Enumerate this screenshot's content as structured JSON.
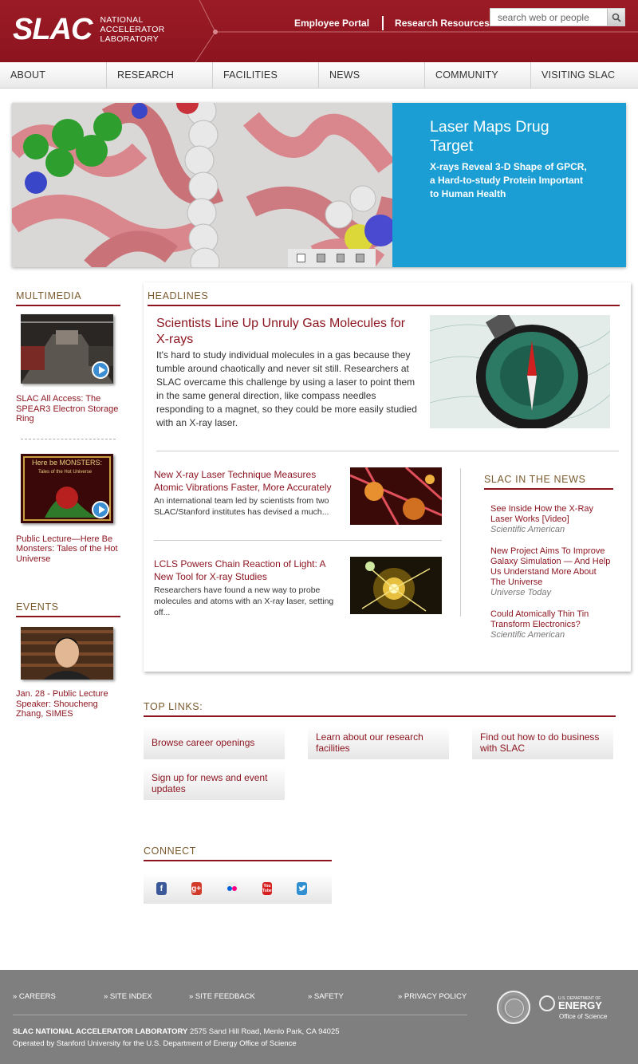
{
  "header": {
    "logo": "SLAC",
    "logo_line1": "NATIONAL",
    "logo_line2": "ACCELERATOR",
    "logo_line3": "LABORATORY",
    "links": [
      "Employee Portal",
      "Research Resources"
    ],
    "search_placeholder": "search web or people",
    "brand_color": "#8c141f"
  },
  "nav": [
    "ABOUT",
    "RESEARCH",
    "FACILITIES",
    "NEWS",
    "COMMUNITY",
    "VISITING SLAC"
  ],
  "slider": {
    "title": "Laser Maps Drug Target",
    "subtitle": "X-rays Reveal 3-D Shape of GPCR, a Hard-to-study Protein Important to Human Health",
    "panel_color": "#1b9ed3",
    "pages": 4,
    "active_page": 1
  },
  "multimedia": {
    "heading": "MULTIMEDIA",
    "items": [
      {
        "caption": "SLAC All Access: The SPEAR3 Electron Storage Ring"
      },
      {
        "caption": "Public Lecture—Here Be Monsters: Tales of the Hot Universe",
        "thumb_text1": "Here be MONSTERS:",
        "thumb_text2": "Tales of the Hot Universe"
      }
    ]
  },
  "events": {
    "heading": "EVENTS",
    "items": [
      {
        "caption": "Jan. 28 - Public Lecture Speaker: Shoucheng Zhang, SIMES"
      }
    ]
  },
  "headlines": {
    "heading": "HEADLINES",
    "main": {
      "title": "Scientists Line Up Unruly Gas Molecules for X-rays",
      "body": "It's hard to study individual molecules in a gas because they tumble around chaotically and never sit still. Researchers at SLAC overcame this challenge by using a laser to point them in the same general direction, like compass needles responding to a magnet, so they could be more easily studied with an X-ray laser."
    },
    "stories": [
      {
        "title": "New X-ray Laser Technique Measures Atomic Vibrations Faster, More Accurately",
        "body": "An international team led by scientists from two SLAC/Stanford institutes has devised a much..."
      },
      {
        "title": "LCLS Powers Chain Reaction of Light: A New Tool for X-ray Studies",
        "body": "Researchers have found a new way to probe molecules and atoms with an X-ray laser, setting off..."
      }
    ]
  },
  "in_the_news": {
    "heading": "SLAC IN THE NEWS",
    "items": [
      {
        "title": "See Inside How the X-Ray Laser Works [Video]",
        "source": "Scientific American"
      },
      {
        "title": "New Project Aims To Improve Galaxy Simulation — And Help Us Understand More About The Universe",
        "source": "Universe Today"
      },
      {
        "title": "Could Atomically Thin Tin Transform Electronics?",
        "source": "Scientific American"
      }
    ]
  },
  "top_links": {
    "heading": "TOP LINKS:",
    "items": [
      "Browse career openings",
      "Learn about our research facilities",
      "Find out how to do business with SLAC",
      "Sign up for news and event updates"
    ]
  },
  "connect": {
    "heading": "CONNECT",
    "icons": [
      "facebook-icon",
      "google-plus-icon",
      "flickr-icon",
      "youtube-icon",
      "twitter-icon"
    ],
    "youtube_label": "You Tube"
  },
  "footer": {
    "links": [
      "» CAREERS",
      "» SITE INDEX",
      "» SITE FEEDBACK",
      "» SAFETY",
      "» PRIVACY POLICY"
    ],
    "lab_name": "SLAC NATIONAL ACCELERATOR LABORATORY",
    "address": " 2575 Sand Hill Road, Menlo Park, CA 94025",
    "operated": "Operated by Stanford University for the U.S. Department of Energy Office of Science",
    "doe_small": "U.S. DEPARTMENT OF",
    "doe_big": "ENERGY",
    "doe_office": "Office of Science"
  }
}
